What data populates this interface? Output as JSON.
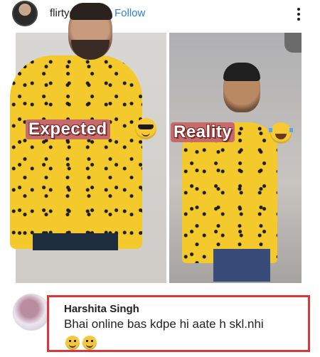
{
  "header": {
    "username": "flirtyology",
    "separator": "•",
    "follow_label": "Follow",
    "avatar_icon": "profile-avatar",
    "more_icon": "more-vertical-icon"
  },
  "post": {
    "left_caption": "Expected",
    "left_emoji": "sunglasses-emoji",
    "right_caption": "Reality",
    "right_emoji": "laughing-tears-emoji"
  },
  "comment": {
    "author": "Harshita Singh",
    "text": "Bhai online bas kdpe hi aate h skl.nhi",
    "emojis": [
      "smile-emoji",
      "smile-emoji"
    ],
    "highlight_color": "#d9373b"
  }
}
